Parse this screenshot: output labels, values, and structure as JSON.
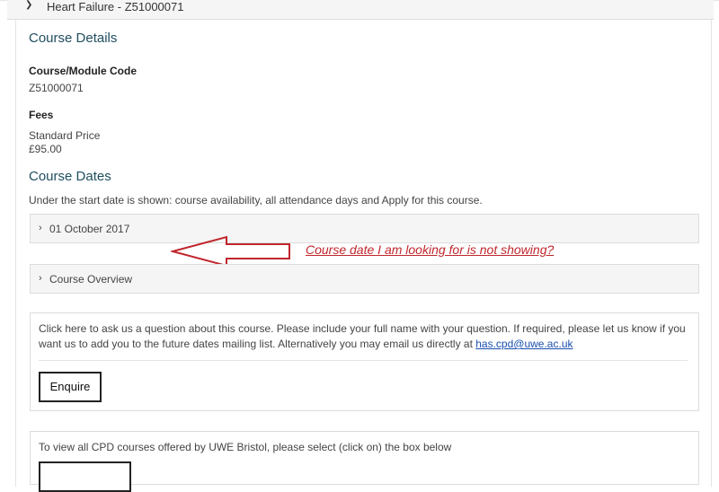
{
  "panel": {
    "title": "Heart Failure - Z51000071"
  },
  "course_details": {
    "heading": "Course Details",
    "code_label": "Course/Module Code",
    "code_value": "Z51000071",
    "fees_label": "Fees",
    "price_label": "Standard Price",
    "price_value": "£95.00"
  },
  "course_dates": {
    "heading": "Course Dates",
    "intro": "Under the start date is shown: course availability, all attendance days and Apply for this course.",
    "date_item": "01 October 2017",
    "overview_item": "Course Overview"
  },
  "annotation": {
    "text": "Course date I am looking for is not showing?",
    "color": "#c0272d"
  },
  "enquire_box": {
    "text": "Click here to ask us a question about this course. Please include your full name with your question. If required, please let us know if you want us to add you to the future dates mailing list. Alternatively you may email us directly at",
    "email": "has.cpd@uwe.ac.uk",
    "button_label": "Enquire"
  },
  "cpd_box": {
    "text": "To view all CPD courses offered by UWE Bristol, please select (click on) the box below"
  },
  "icons": {
    "panel_toggle": "chevron-down-icon",
    "accordion_toggle": "chevron-right-icon"
  }
}
